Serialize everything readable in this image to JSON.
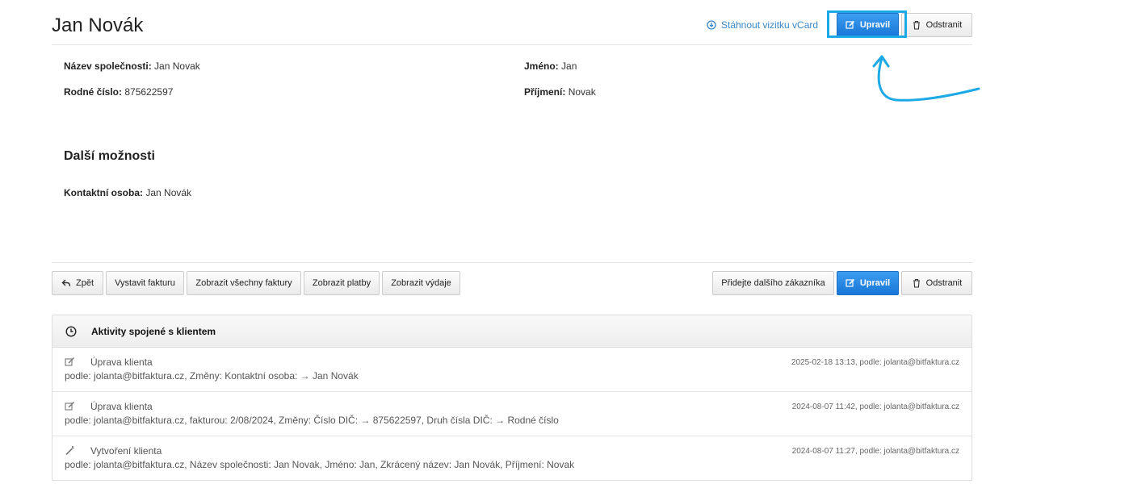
{
  "header": {
    "title": "Jan Novák",
    "vcard_label": "Stáhnout vizitku vCard",
    "edit_label": "Upravil",
    "delete_label": "Odstranit"
  },
  "details": {
    "company": {
      "label": "Název společnosti:",
      "value": "Jan Novak"
    },
    "birth_number": {
      "label": "Rodné číslo:",
      "value": "875622597"
    },
    "first_name": {
      "label": "Jméno:",
      "value": "Jan"
    },
    "last_name": {
      "label": "Příjmení:",
      "value": "Novak"
    }
  },
  "more_options": {
    "title": "Další možnosti",
    "contact_person": {
      "label": "Kontaktní osoba:",
      "value": "Jan Novák"
    }
  },
  "toolbar": {
    "back_label": "Zpět",
    "issue_invoice_label": "Vystavit fakturu",
    "show_all_invoices_label": "Zobrazit všechny faktury",
    "show_payments_label": "Zobrazit platby",
    "show_expenses_label": "Zobrazit výdaje",
    "add_customer_label": "Přidejte dalšího zákazníka",
    "edit_label": "Upravil",
    "delete_label": "Odstranit"
  },
  "activities": {
    "title": "Aktivity spojené s klientem",
    "items": [
      {
        "icon": "edit-icon",
        "title": "Úprava klienta",
        "detail": "podle: jolanta@bitfaktura.cz, Změny: Kontaktní osoba: → Jan Novák",
        "time": "2025-02-18 13:13, podle: jolanta@bitfaktura.cz"
      },
      {
        "icon": "edit-icon",
        "title": "Úprava klienta",
        "detail": "podle: jolanta@bitfaktura.cz, fakturou: 2/08/2024, Změny: Číslo DIČ: → 875622597, Druh čísla DIČ: → Rodné číslo",
        "time": "2024-08-07 11:42, podle: jolanta@bitfaktura.cz"
      },
      {
        "icon": "magic-wand-icon",
        "title": "Vytvoření klienta",
        "detail": "podle: jolanta@bitfaktura.cz, Název společnosti: Jan Novak, Jméno: Jan, Zkrácený název: Jan Novák, Příjmení: Novak",
        "time": "2024-08-07 11:27, podle: jolanta@bitfaktura.cz"
      }
    ]
  },
  "colors": {
    "primary": "#1976d8",
    "link": "#3a87c8",
    "annotation": "#1da9e6"
  }
}
